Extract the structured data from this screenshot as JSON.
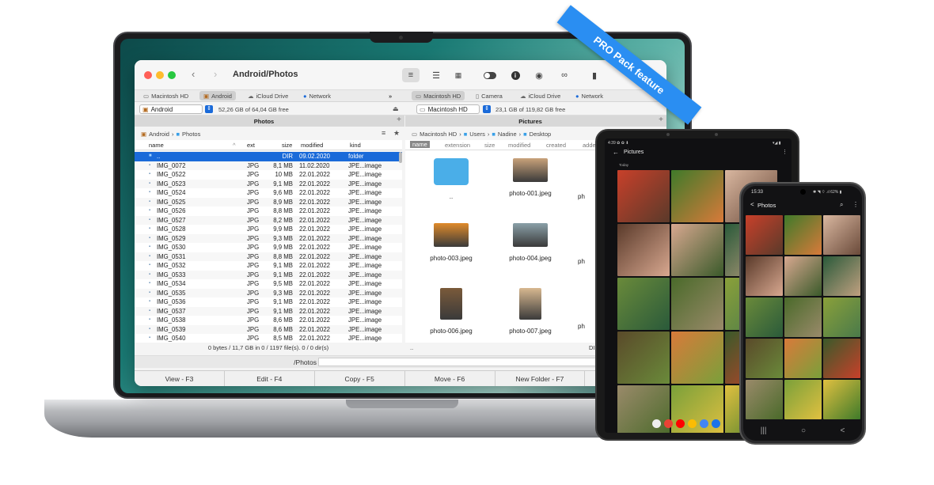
{
  "ribbon": {
    "label": "PRO Pack feature"
  },
  "window": {
    "title": "Android/Photos",
    "toolbar_icons": [
      "list-view-icon",
      "detail-view-icon",
      "grid-view-icon",
      "toggle-icon",
      "info-icon",
      "eye-icon",
      "binoculars-icon",
      "archive-icon",
      "download-icon"
    ],
    "left_tabs": [
      {
        "label": "Macintosh HD",
        "selected": false
      },
      {
        "label": "Android",
        "selected": true
      },
      {
        "label": "iCloud Drive",
        "selected": false
      },
      {
        "label": "Network",
        "selected": false
      }
    ],
    "more_label": "»",
    "right_tabs": [
      {
        "label": "Macintosh HD",
        "selected": true
      },
      {
        "label": "Camera",
        "selected": false
      },
      {
        "label": "iCloud Drive",
        "selected": false
      },
      {
        "label": "Network",
        "selected": false
      }
    ],
    "left_drive": {
      "name": "Android",
      "free": "52,26 GB of 64,04 GB free"
    },
    "right_drive": {
      "name": "Macintosh HD",
      "free": "23,1 GB of 119,82 GB free"
    },
    "left_panel_title": "Photos",
    "right_panel_title": "Pictures",
    "left_breadcrumb": [
      "Android",
      "Photos"
    ],
    "right_breadcrumb": [
      "Macintosh HD",
      "Users",
      "Nadine",
      "Desktop"
    ],
    "left_columns": {
      "name": "name",
      "ext": "ext",
      "size": "size",
      "modified": "modified",
      "kind": "kind"
    },
    "right_columns": {
      "name": "name",
      "extension": "extension",
      "size": "size",
      "modified": "modified",
      "created": "created",
      "added": "adde"
    },
    "files": [
      {
        "name": "..",
        "ext": "",
        "size": "DIR",
        "modified": "09.02.2020",
        "kind": "folder",
        "selected": true
      },
      {
        "name": "IMG_0072",
        "ext": "JPG",
        "size": "8,1 MB",
        "modified": "11.02.2020",
        "kind": "JPE...image"
      },
      {
        "name": "IMG_0522",
        "ext": "JPG",
        "size": "10 MB",
        "modified": "22.01.2022",
        "kind": "JPE...image"
      },
      {
        "name": "IMG_0523",
        "ext": "JPG",
        "size": "9,1 MB",
        "modified": "22.01.2022",
        "kind": "JPE...image"
      },
      {
        "name": "IMG_0524",
        "ext": "JPG",
        "size": "9,6 MB",
        "modified": "22.01.2022",
        "kind": "JPE...image"
      },
      {
        "name": "IMG_0525",
        "ext": "JPG",
        "size": "8,9 MB",
        "modified": "22.01.2022",
        "kind": "JPE...image"
      },
      {
        "name": "IMG_0526",
        "ext": "JPG",
        "size": "8,8 MB",
        "modified": "22.01.2022",
        "kind": "JPE...image"
      },
      {
        "name": "IMG_0527",
        "ext": "JPG",
        "size": "8,2 MB",
        "modified": "22.01.2022",
        "kind": "JPE...image"
      },
      {
        "name": "IMG_0528",
        "ext": "JPG",
        "size": "9,9 MB",
        "modified": "22.01.2022",
        "kind": "JPE...image"
      },
      {
        "name": "IMG_0529",
        "ext": "JPG",
        "size": "9,3 MB",
        "modified": "22.01.2022",
        "kind": "JPE...image"
      },
      {
        "name": "IMG_0530",
        "ext": "JPG",
        "size": "9,9 MB",
        "modified": "22.01.2022",
        "kind": "JPE...image"
      },
      {
        "name": "IMG_0531",
        "ext": "JPG",
        "size": "8,8 MB",
        "modified": "22.01.2022",
        "kind": "JPE...image"
      },
      {
        "name": "IMG_0532",
        "ext": "JPG",
        "size": "9,1 MB",
        "modified": "22.01.2022",
        "kind": "JPE...image"
      },
      {
        "name": "IMG_0533",
        "ext": "JPG",
        "size": "9,1 MB",
        "modified": "22.01.2022",
        "kind": "JPE...image"
      },
      {
        "name": "IMG_0534",
        "ext": "JPG",
        "size": "9,5 MB",
        "modified": "22.01.2022",
        "kind": "JPE...image"
      },
      {
        "name": "IMG_0535",
        "ext": "JPG",
        "size": "9,3 MB",
        "modified": "22.01.2022",
        "kind": "JPE...image"
      },
      {
        "name": "IMG_0536",
        "ext": "JPG",
        "size": "9,1 MB",
        "modified": "22.01.2022",
        "kind": "JPE...image"
      },
      {
        "name": "IMG_0537",
        "ext": "JPG",
        "size": "9,1 MB",
        "modified": "22.01.2022",
        "kind": "JPE...image"
      },
      {
        "name": "IMG_0538",
        "ext": "JPG",
        "size": "8,6 MB",
        "modified": "22.01.2022",
        "kind": "JPE...image"
      },
      {
        "name": "IMG_0539",
        "ext": "JPG",
        "size": "8,6 MB",
        "modified": "22.01.2022",
        "kind": "JPE...image"
      },
      {
        "name": "IMG_0540",
        "ext": "JPG",
        "size": "8,5 MB",
        "modified": "22.01.2022",
        "kind": "JPE...image"
      }
    ],
    "thumbnails": [
      {
        "label": "..",
        "kind": "folder"
      },
      {
        "label": "photo-001.jpeg",
        "kind": "photo",
        "color": "#c9a27a"
      },
      {
        "label": "ph",
        "kind": "partial"
      },
      {
        "label": "photo-003.jpeg",
        "kind": "photo",
        "color": "#e08a2a"
      },
      {
        "label": "photo-004.jpeg",
        "kind": "photo",
        "color": "#8aa0a8"
      },
      {
        "label": "ph",
        "kind": "partial"
      },
      {
        "label": "photo-006.jpeg",
        "kind": "photo",
        "color": "#7a5a3a"
      },
      {
        "label": "photo-007.jpeg",
        "kind": "photo",
        "color": "#d8b890"
      },
      {
        "label": "ph",
        "kind": "partial"
      }
    ],
    "left_status": "0 bytes / 11,7 GB in 0 / 1197 file(s). 0 / 0 dir(s)",
    "right_status_left": "..",
    "right_status_right": "DIR",
    "path": "/Photos",
    "function_keys": [
      "View - F3",
      "Edit - F4",
      "Copy - F5",
      "Move - F6",
      "New Folder - F7"
    ]
  },
  "tablet": {
    "status_left": "4:39 ✿ ✿ ⬇",
    "status_right": "▾◢ ▮",
    "app_title": "Pictures",
    "section_label": "Today",
    "back_label": "←",
    "menu_label": "⋮"
  },
  "phone": {
    "time": "15:33",
    "status_right": "✱ ◥ ⌔ .ıl 62% ▮",
    "app_title": "Photos",
    "back_label": "<",
    "nav": [
      "|||",
      "○",
      "<"
    ]
  }
}
